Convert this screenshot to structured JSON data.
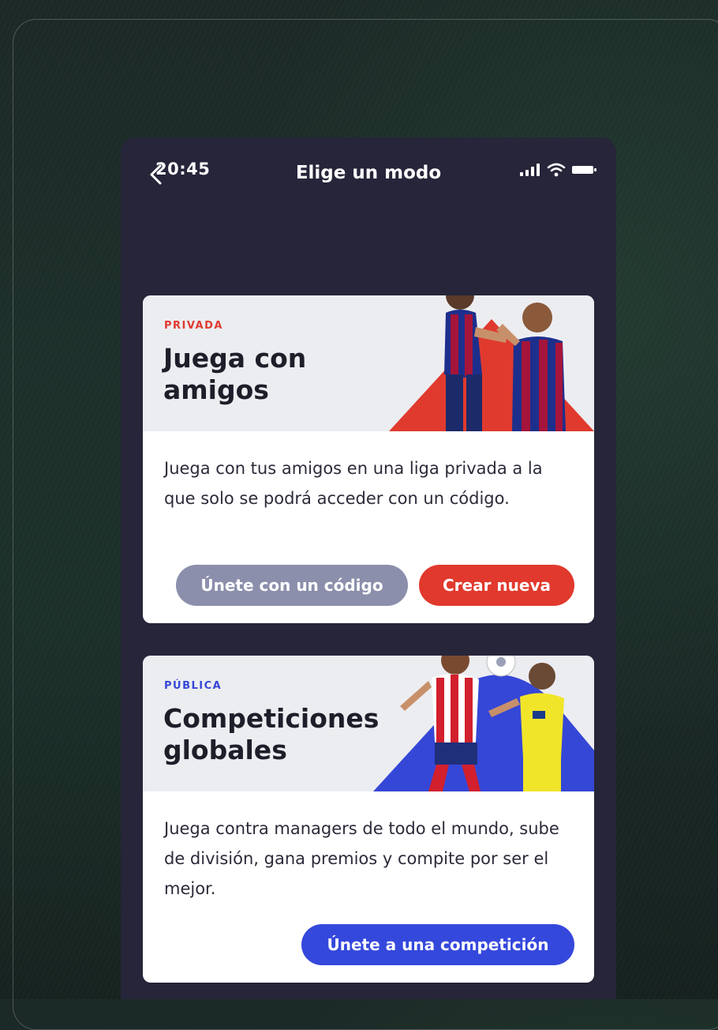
{
  "status_bar": {
    "time": "20:45",
    "title": "Elige un modo",
    "icons": [
      "back-arrow-icon",
      "cellular-signal-icon",
      "wifi-icon",
      "battery-icon"
    ]
  },
  "cards": [
    {
      "tag": "PRIVADA",
      "title": "Juega con amigos",
      "description": "Juega con tus amigos en una liga privada a la que solo se podrá acceder con un código.",
      "buttons": [
        {
          "label": "Únete con un código",
          "color": "#8b8fab"
        },
        {
          "label": "Crear nueva",
          "color": "#e1392d"
        }
      ],
      "accent": "#e03a2e"
    },
    {
      "tag": "PÚBLICA",
      "title": "Competiciones globales",
      "description": "Juega contra managers de todo el mundo, sube de división, gana premios y compite por ser el mejor.",
      "buttons": [
        {
          "label": "Únete a una competición",
          "color": "#3548dc"
        }
      ],
      "accent": "#3547d6"
    }
  ],
  "colors": {
    "phone_background": "#262539",
    "card_header_background": "#ecedf1",
    "card_background": "#ffffff"
  }
}
